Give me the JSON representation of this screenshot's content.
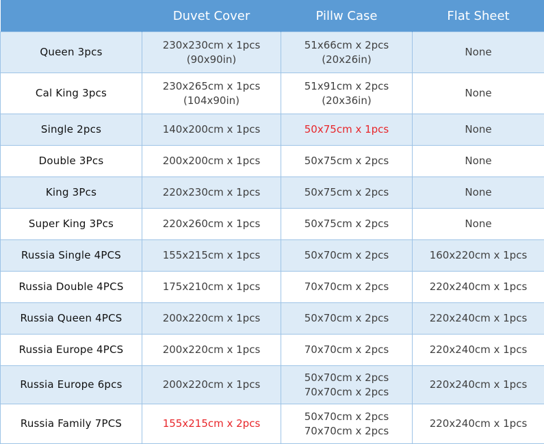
{
  "header": {
    "corner": "",
    "duvet": "Duvet Cover",
    "pillow": "Pillw Case",
    "flat": "Flat Sheet"
  },
  "rows": [
    {
      "name": "Queen 3pcs",
      "duvet": [
        "230x230cm x 1pcs",
        "(90x90in)"
      ],
      "pillow": [
        "51x66cm x 2pcs",
        "(20x26in)"
      ],
      "flat": [
        "None"
      ]
    },
    {
      "name": "Cal King 3pcs",
      "duvet": [
        "230x265cm x 1pcs",
        "(104x90in)"
      ],
      "pillow": [
        "51x91cm x 2pcs",
        "(20x36in)"
      ],
      "flat": [
        "None"
      ]
    },
    {
      "name": "Single 2pcs",
      "duvet": [
        "140x200cm x 1pcs"
      ],
      "pillow": [
        "50x75cm x 1pcs"
      ],
      "flat": [
        "None"
      ]
    },
    {
      "name": "Double 3Pcs",
      "duvet": [
        "200x200cm x 1pcs"
      ],
      "pillow": [
        "50x75cm x 2pcs"
      ],
      "flat": [
        "None"
      ]
    },
    {
      "name": "King 3Pcs",
      "duvet": [
        "220x230cm x 1pcs"
      ],
      "pillow": [
        "50x75cm x 2pcs"
      ],
      "flat": [
        "None"
      ]
    },
    {
      "name": "Super King 3Pcs",
      "duvet": [
        "220x260cm x 1pcs"
      ],
      "pillow": [
        "50x75cm x 2pcs"
      ],
      "flat": [
        "None"
      ]
    },
    {
      "name": "Russia Single 4PCS",
      "duvet": [
        "155x215cm x 1pcs"
      ],
      "pillow": [
        "50x70cm x 2pcs"
      ],
      "flat": [
        "160x220cm x 1pcs"
      ]
    },
    {
      "name": "Russia Double 4PCS",
      "duvet": [
        "175x210cm x 1pcs"
      ],
      "pillow": [
        "70x70cm x 2pcs"
      ],
      "flat": [
        "220x240cm x 1pcs"
      ]
    },
    {
      "name": "Russia Queen 4PCS",
      "duvet": [
        "200x220cm x 1pcs"
      ],
      "pillow": [
        "50x70cm x 2pcs"
      ],
      "flat": [
        "220x240cm x 1pcs"
      ]
    },
    {
      "name": "Russia Europe 4PCS",
      "duvet": [
        "200x220cm x 1pcs"
      ],
      "pillow": [
        "70x70cm x 2pcs"
      ],
      "flat": [
        "220x240cm x 1pcs"
      ]
    },
    {
      "name": "Russia Europe 6pcs",
      "duvet": [
        "200x220cm x 1pcs"
      ],
      "pillow": [
        "50x70cm x 2pcs",
        "70x70cm x 2pcs"
      ],
      "flat": [
        "220x240cm x 1pcs"
      ]
    },
    {
      "name": "Russia Family 7PCS",
      "duvet": [
        "155x215cm x 2pcs"
      ],
      "pillow": [
        "50x70cm x 2pcs",
        "70x70cm x 2pcs"
      ],
      "flat": [
        "220x240cm x 1pcs"
      ]
    }
  ],
  "highlights": [
    {
      "row": 2,
      "column": "pillow"
    },
    {
      "row": 11,
      "column": "duvet"
    }
  ],
  "colors": {
    "header_bg": "#5b9bd5",
    "header_text": "#ffffff",
    "band_bg": "#ddebf7",
    "border": "#9dc3e6",
    "highlight_text": "#e8262a"
  }
}
